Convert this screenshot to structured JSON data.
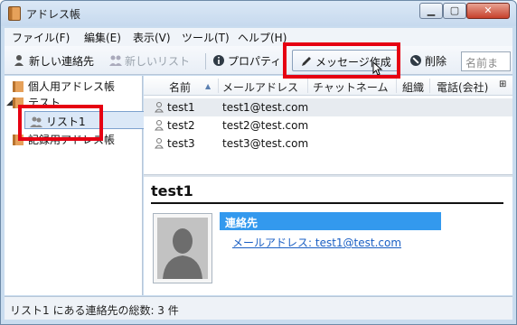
{
  "window": {
    "title": "アドレス帳",
    "minimize": "▁",
    "maximize": "▢",
    "close": "✕"
  },
  "menu": [
    {
      "label": "ファイル(F)"
    },
    {
      "label": "編集(E)"
    },
    {
      "label": "表示(V)"
    },
    {
      "label": "ツール(T)"
    },
    {
      "label": "ヘルプ(H)"
    }
  ],
  "toolbar": {
    "new_contact": "新しい連絡先",
    "new_list": "新しいリスト",
    "properties": "プロパティ",
    "compose": "メッセージ作成",
    "delete": "削除",
    "search_placeholder": "名前ま"
  },
  "sidebar": {
    "items": [
      {
        "label": "個人用アドレス帳"
      },
      {
        "label": "テスト"
      },
      {
        "label": "リスト1"
      },
      {
        "label": "記録用アドレス帳"
      }
    ]
  },
  "list": {
    "columns": [
      "名前",
      "メールアドレス",
      "チャットネーム",
      "組織",
      "電話(会社)"
    ],
    "sort_indicator": "▲",
    "rows": [
      {
        "name": "test1",
        "email": "test1@test.com"
      },
      {
        "name": "test2",
        "email": "test2@test.com"
      },
      {
        "name": "test3",
        "email": "test3@test.com"
      }
    ]
  },
  "card": {
    "name": "test1",
    "section": "連絡先",
    "email_line": "メールアドレス: test1@test.com"
  },
  "status": {
    "text": "リスト1 にある連絡先の総数: 3 件"
  },
  "colors": {
    "highlight": "#e60012",
    "section_head": "#3399ee"
  },
  "icons": {
    "address_book": "address-book-icon",
    "person": "person-icon",
    "pencil": "pencil-icon",
    "delete": "delete-icon",
    "info": "info-icon"
  }
}
